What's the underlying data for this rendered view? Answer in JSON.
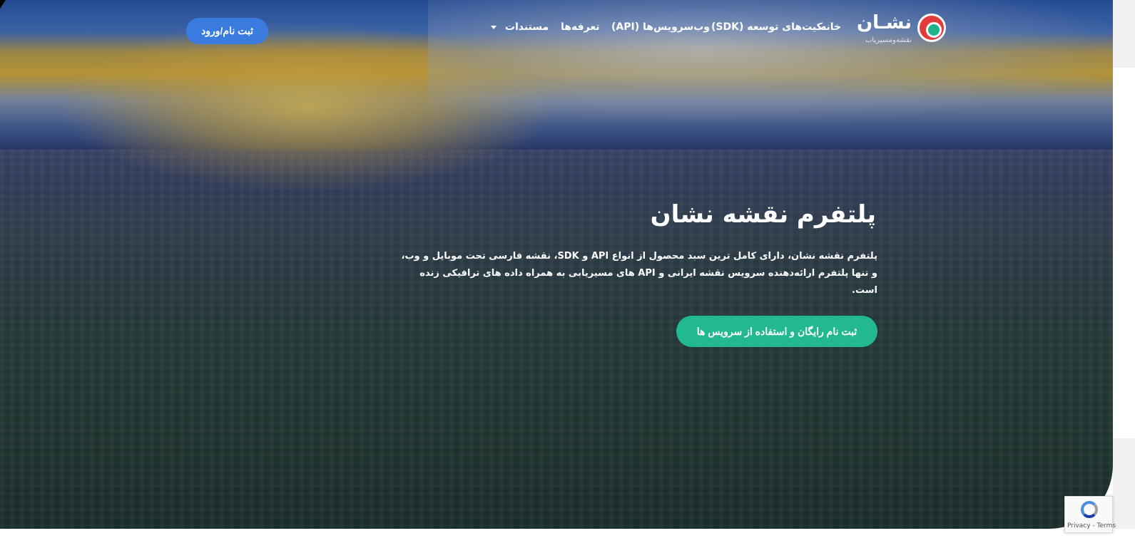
{
  "nav": {
    "logo_text": "نشـان",
    "logo_subtitle": "نقشه‌ومسیریاب",
    "home": "خانه",
    "sdk": "کیت‌های توسعه (SDK)",
    "api": "وب‌سرویس‌ها (API)",
    "pricing": "تعرفه‌ها",
    "docs": "مستندات",
    "login": "ثبت نام/ورود"
  },
  "hero": {
    "title": "پلتفرم نقشه نشان",
    "description": "پلتفرم نقشه نشان، دارای کامل ترین سبد محصول از انواع API و SDK، نقشه فارسی تحت موبایل و وب، و تنها پلتفرم ارائه‌دهنده سرویس نقشه ایرانی و API های مسیریابی به همراه داده های ترافیکی زنده است.",
    "cta": "ثبت نام رایگان و استفاده از سرویس ها"
  },
  "recaptcha": {
    "text": "Privacy - Terms"
  },
  "colors": {
    "login_button": "#3a7be0",
    "cta_button": "#22b890"
  }
}
